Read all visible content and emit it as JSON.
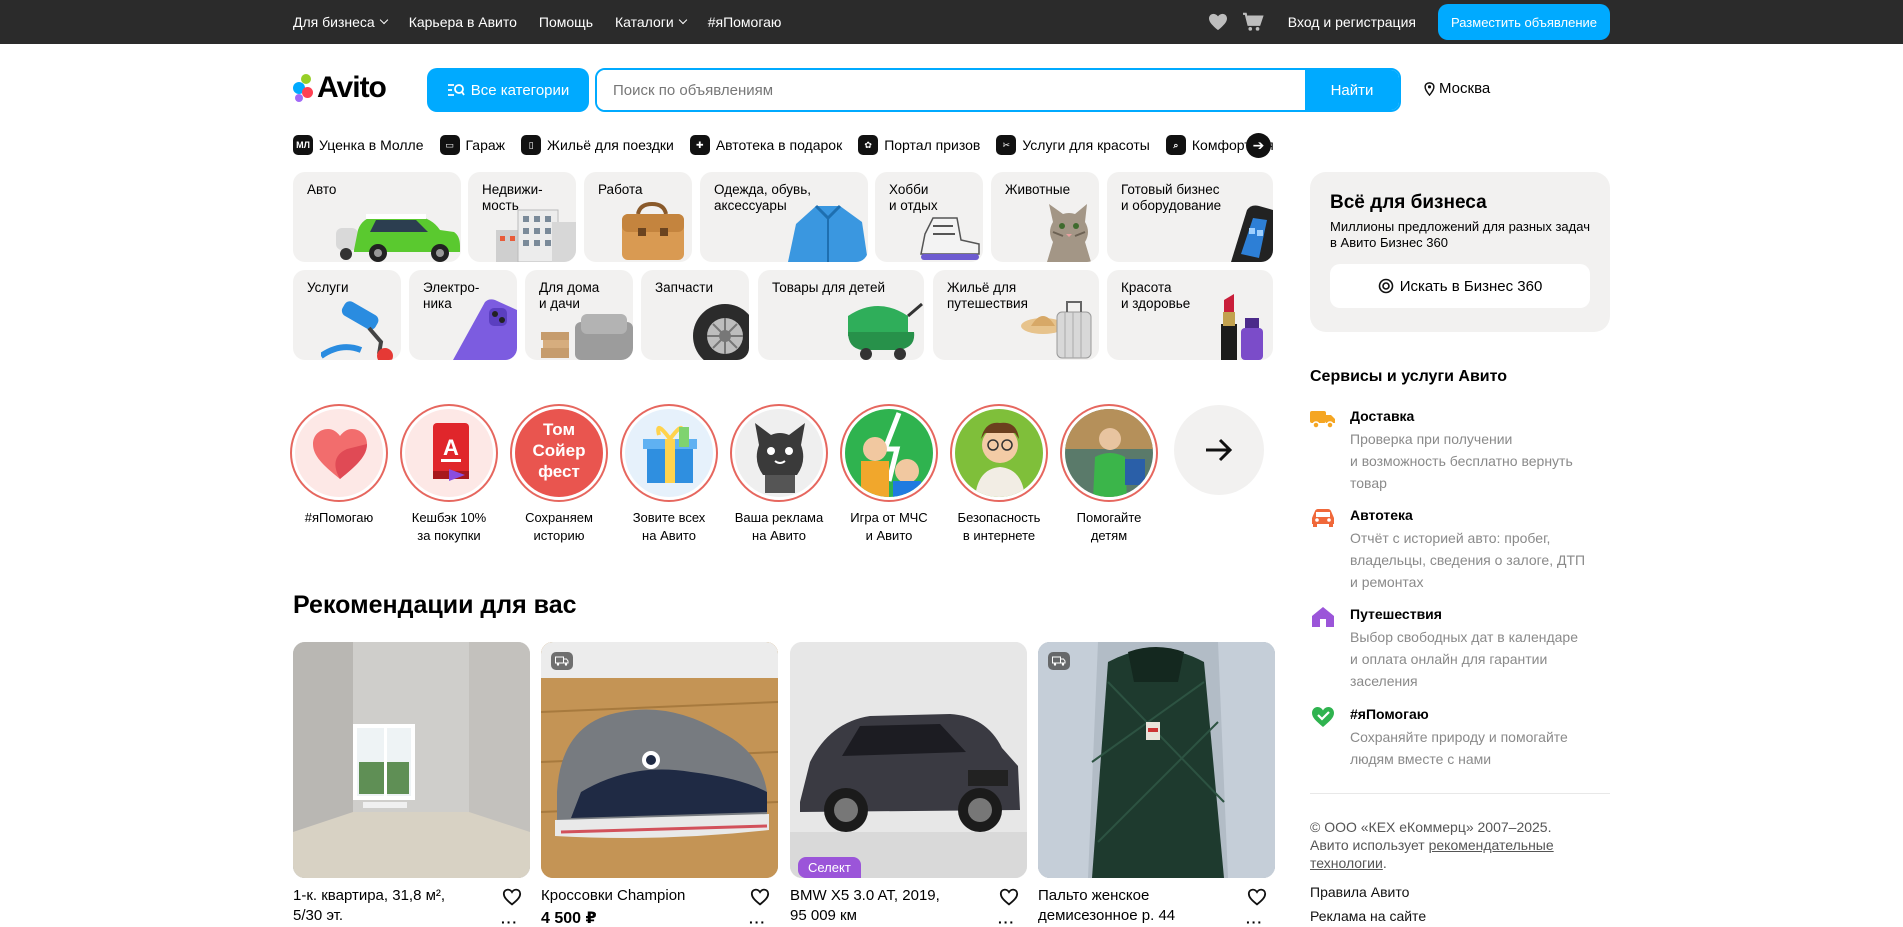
{
  "topbar": {
    "nav": [
      "Для бизнеса",
      "Карьера в Авито",
      "Помощь",
      "Каталоги",
      "#яПомогаю"
    ],
    "login": "Вход и регистрация",
    "post_button": "Разместить объявление"
  },
  "header": {
    "logo": "Avito",
    "all_categories": "Все категории",
    "search_placeholder": "Поиск по объявлениям",
    "search_button": "Найти",
    "city": "Москва"
  },
  "quick_links": [
    "Уценка в Молле",
    "Гараж",
    "Жильё для поездки",
    "Автотека в подарок",
    "Портал призов",
    "Услуги для красоты",
    "Комфортная"
  ],
  "categories_row1": [
    "Авто",
    "Недвижи-\nмость",
    "Работа",
    "Одежда, обувь,\nаксессуары",
    "Хобби\nи отдых",
    "Животные",
    "Готовый бизнес\nи оборудование"
  ],
  "categories_row2": [
    "Услуги",
    "Электро-\nника",
    "Для дома\nи дачи",
    "Запчасти",
    "Товары для детей",
    "Жильё для\nпутешествия",
    "Красота\nи здоровье"
  ],
  "stories": [
    "#яПомогаю",
    "Кешбэк 10%\nза покупки",
    "Сохраняем\nисторию",
    "Зовите всех\nна Авито",
    "Ваша реклама\nна Авито",
    "Игра от МЧС\nи Авито",
    "Безопасность\nв интернете",
    "Помогайте\nдетям"
  ],
  "story_art": {
    "tom": "Том\nСойер\nфест",
    "alfa": "А"
  },
  "recommendations": {
    "title": "Рекомендации для вас",
    "items": [
      {
        "title": "1-к. квартира, 31,8 м²,\n5/30 эт.",
        "price": ""
      },
      {
        "title": "Кроссовки Champion",
        "price": "4 500 ₽"
      },
      {
        "title": "BMW X5 3.0 AT, 2019,\n95 009 км",
        "price": "",
        "badge": "Селект"
      },
      {
        "title": "Пальто женское\nдемисезонное р. 44",
        "price": ""
      }
    ]
  },
  "business": {
    "title": "Всё для бизнеса",
    "text": "Миллионы предложений для разных задач в Авито Бизнес 360",
    "button": "Искать в Бизнес 360"
  },
  "services": {
    "title": "Сервисы и услуги Авито",
    "items": [
      {
        "title": "Доставка",
        "text": "Проверка при получении\nи возможность бесплатно вернуть\nтовар"
      },
      {
        "title": "Автотека",
        "text": "Отчёт с историей авто: пробег,\nвладельцы, сведения о залоге, ДТП\nи ремонтах"
      },
      {
        "title": "Путешествия",
        "text": "Выбор свободных дат в календаре\nи оплата онлайн для гарантии\nзаселения"
      },
      {
        "title": "#яПомогаю",
        "text": "Сохраняйте природу и помогайте\nлюдям вместе с нами"
      }
    ]
  },
  "footer": {
    "copyright": "© ООО «КЕХ еКоммерц» 2007–2025.",
    "uses": "Авито использует",
    "link1": "рекомендательные",
    "link2": "технологии",
    "dot": ".",
    "rules": "Правила Авито",
    "ads": "Реклама на сайте"
  },
  "colors": {
    "accent": "#00aaff",
    "topbar": "#2b2b2b",
    "tile": "#f2f1f0",
    "story_ring": "#e6675f",
    "select": "#9b55d9"
  }
}
